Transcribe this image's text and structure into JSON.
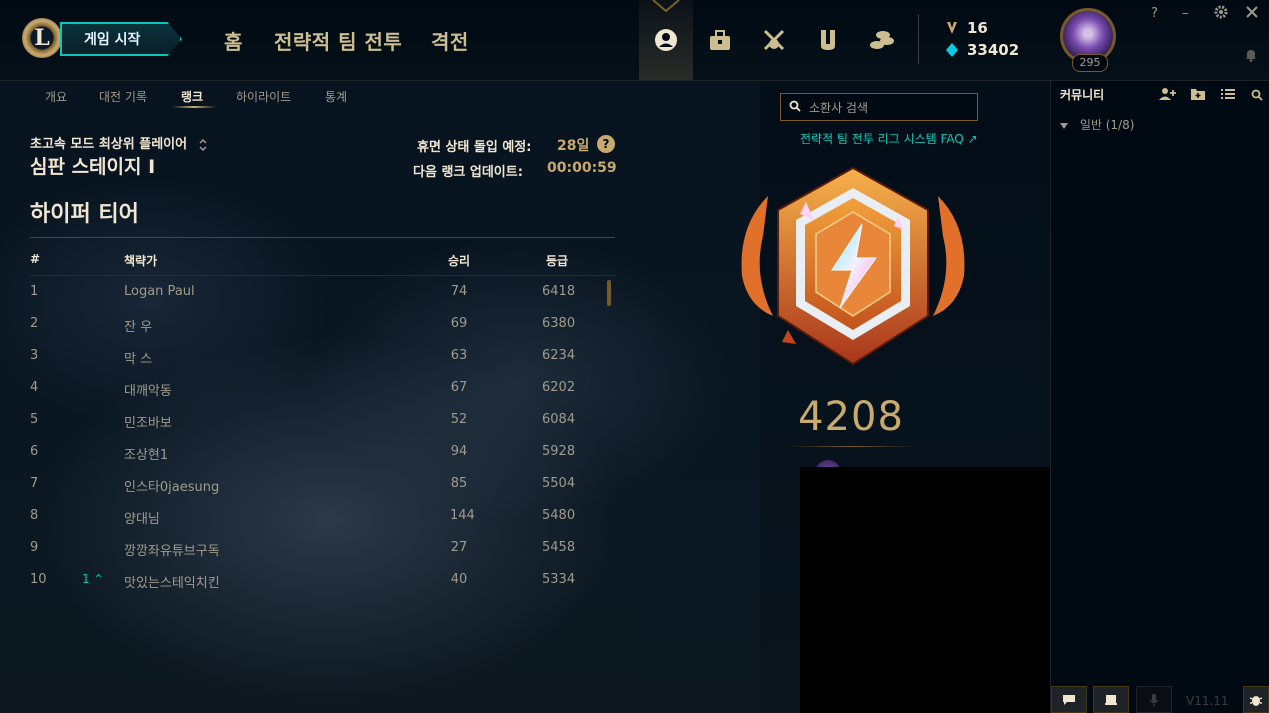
{
  "header": {
    "play_button": "게임 시작",
    "logo_letter": "L",
    "nav": [
      "홈",
      "전략적 팀 전투",
      "격전"
    ],
    "currency": {
      "rp": "16",
      "be": "33402"
    },
    "profile_level": "295",
    "window_controls": {
      "help": "?",
      "minimize": "–"
    },
    "icons": [
      "profile-icon",
      "collection-icon",
      "loot-icon",
      "store-icon",
      "currency-icon"
    ]
  },
  "subnav": {
    "tabs": [
      "개요",
      "대전 기록",
      "랭크",
      "하이라이트",
      "통계"
    ],
    "active": "랭크"
  },
  "ranked": {
    "queue": "초고속 모드 최상위 플레이어",
    "tier_stage": "심판 스테이지 I",
    "decay_label": "휴면 상태 돌입 예정:",
    "decay_value": "28일",
    "update_label": "다음 랭크 업데이트:",
    "update_value": "00:00:59",
    "section_title": "하이퍼 티어",
    "lp": "4208"
  },
  "table": {
    "headers": [
      "#",
      "책략가",
      "승리",
      "등급"
    ],
    "rows": [
      {
        "rank": "1",
        "change": "",
        "name": "Logan Paul",
        "wins": "74",
        "rating": "6418"
      },
      {
        "rank": "2",
        "change": "",
        "name": "잔 우",
        "wins": "69",
        "rating": "6380"
      },
      {
        "rank": "3",
        "change": "",
        "name": "막 스",
        "wins": "63",
        "rating": "6234"
      },
      {
        "rank": "4",
        "change": "",
        "name": "대깨악동",
        "wins": "67",
        "rating": "6202"
      },
      {
        "rank": "5",
        "change": "",
        "name": "민조바보",
        "wins": "52",
        "rating": "6084"
      },
      {
        "rank": "6",
        "change": "",
        "name": "조상현1",
        "wins": "94",
        "rating": "5928"
      },
      {
        "rank": "7",
        "change": "",
        "name": "인스타0jaesung",
        "wins": "85",
        "rating": "5504"
      },
      {
        "rank": "8",
        "change": "",
        "name": "양대님",
        "wins": "144",
        "rating": "5480"
      },
      {
        "rank": "9",
        "change": "",
        "name": "깡깡좌유튜브구독",
        "wins": "27",
        "rating": "5458"
      },
      {
        "rank": "10",
        "change": "1 ⌃",
        "name": "맛있는스테익치킨",
        "wins": "40",
        "rating": "5334"
      }
    ]
  },
  "search": {
    "placeholder": "소환사 검색"
  },
  "faq_link": "전략적 팀 전투 리그 시스템 FAQ ↗",
  "social": {
    "title": "커뮤니티",
    "group": "일반 (1/8)"
  },
  "footer": {
    "version": "V11.11"
  },
  "colors": {
    "gold": "#c8aa6e",
    "teal": "#0ac8b9",
    "background": "#010a13"
  }
}
